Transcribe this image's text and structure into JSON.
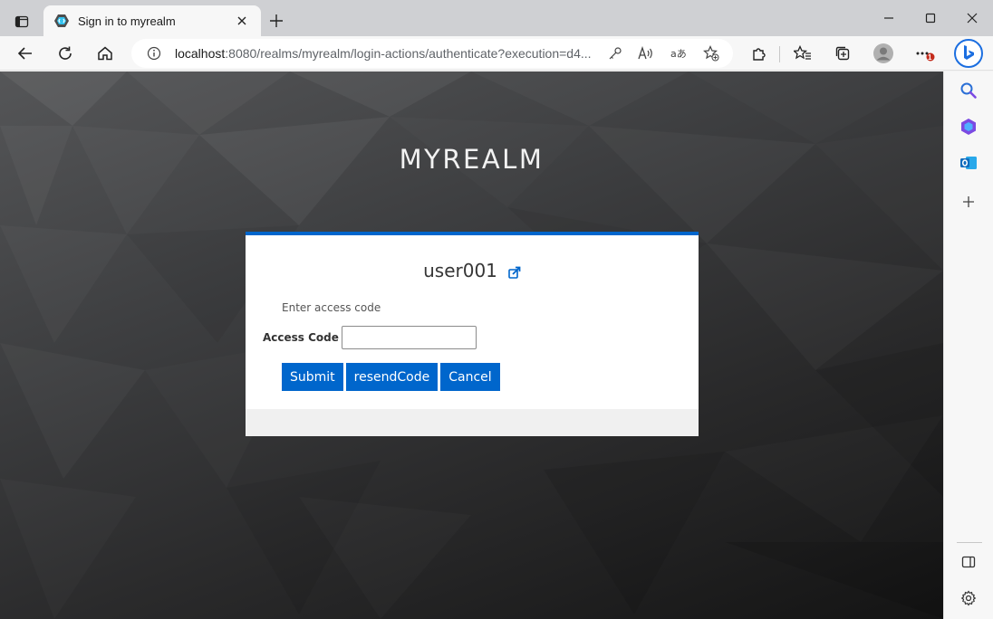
{
  "browser": {
    "tab": {
      "title": "Sign in to myrealm",
      "favicon": "keycloak-icon"
    },
    "address": {
      "host": "localhost",
      "rest": ":8080/realms/myrealm/login-actions/authenticate?execution=d4..."
    },
    "notification_badge": "1",
    "icons": {
      "tab_actions": "tab-actions-icon",
      "close_tab": "close-icon",
      "new_tab": "plus-icon",
      "back": "back-arrow-icon",
      "refresh": "refresh-icon",
      "home": "home-icon",
      "site_info": "info-icon",
      "password": "key-icon",
      "read_aloud": "read-aloud-icon",
      "translate": "translate-icon",
      "add_favorite": "star-plus-icon",
      "extensions": "puzzle-icon",
      "favorites": "favorites-icon",
      "collections": "collections-icon",
      "profile": "profile-icon",
      "more": "more-icon",
      "copilot": "bing-icon"
    }
  },
  "sidebar": {
    "items": [
      "search-icon",
      "copilot-icon",
      "outlook-icon",
      "add-icon"
    ],
    "bottom": [
      "split-panel-icon",
      "settings-icon"
    ]
  },
  "page": {
    "realm_title": "MYREALM",
    "username": "user001",
    "hint": "Enter access code",
    "field_label": "Access Code",
    "field_value": "",
    "buttons": {
      "submit": "Submit",
      "resend": "resendCode",
      "cancel": "Cancel"
    }
  },
  "colors": {
    "primary": "#0066cc",
    "card_footer": "#f0f0f0",
    "background_dark": "#2a2a2b"
  }
}
